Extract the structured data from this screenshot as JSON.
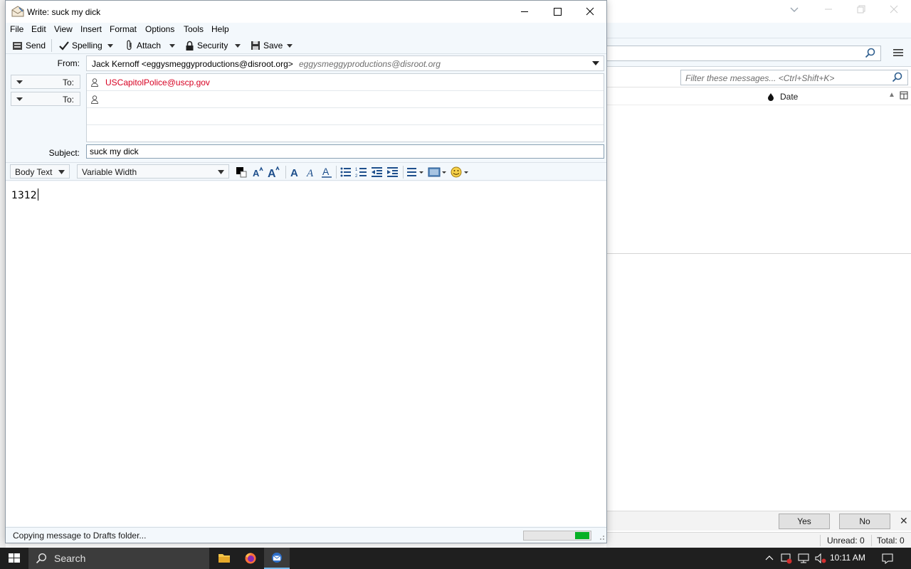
{
  "main_window": {
    "filter_placeholder": "Filter these messages... <Ctrl+Shift+K>",
    "column_date": "Date",
    "notification": {
      "yes_label": "Yes",
      "no_label": "No"
    },
    "status": {
      "unread": "Unread: 0",
      "total": "Total: 0"
    }
  },
  "compose": {
    "window_title": "Write: suck my dick",
    "menu": [
      "File",
      "Edit",
      "View",
      "Insert",
      "Format",
      "Options",
      "Tools",
      "Help"
    ],
    "toolbar": {
      "send": "Send",
      "spelling": "Spelling",
      "attach": "Attach",
      "security": "Security",
      "save": "Save"
    },
    "from_label": "From:",
    "from_name": "Jack Kernoff <eggysmeggyproductions@disroot.org>",
    "from_identity": "eggysmeggyproductions@disroot.org",
    "recipients": [
      {
        "type": "To:",
        "address": "USCapitolPolice@uscp.gov"
      },
      {
        "type": "To:",
        "address": ""
      }
    ],
    "subject_label": "Subject:",
    "subject_value": "suck my dick",
    "format": {
      "paragraph_style": "Body Text",
      "font": "Variable Width"
    },
    "body_text": "1312",
    "status_message": "Copying message to Drafts folder...",
    "progress_fraction": 0.22
  },
  "taskbar": {
    "search_label": "Search",
    "clock": "10:11 AM"
  },
  "colors": {
    "window_bg": "#f3f8fc",
    "recipient_red": "#d70022",
    "progress_green": "#06b025",
    "taskbar": "#1f1f1f"
  }
}
